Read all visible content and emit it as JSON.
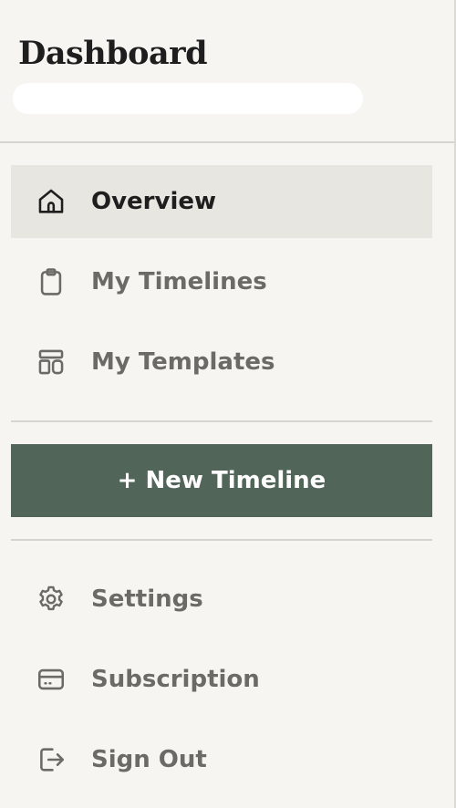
{
  "header": {
    "title": "Dashboard"
  },
  "nav": {
    "overview": {
      "label": "Overview",
      "icon": "home-icon",
      "active": true
    },
    "timelines": {
      "label": "My Timelines",
      "icon": "clipboard-icon"
    },
    "templates": {
      "label": "My Templates",
      "icon": "layout-icon"
    }
  },
  "actions": {
    "new_timeline_label": "+ New Timeline"
  },
  "account": {
    "settings": {
      "label": "Settings",
      "icon": "gear-icon"
    },
    "subscription": {
      "label": "Subscription",
      "icon": "credit-card-icon"
    },
    "sign_out": {
      "label": "Sign Out",
      "icon": "logout-icon"
    }
  },
  "colors": {
    "accent": "#516658",
    "background": "#f6f5f2",
    "active_bg": "#e8e6e1",
    "text_dark": "#1e1e1e",
    "text_muted": "#6b6a66"
  }
}
